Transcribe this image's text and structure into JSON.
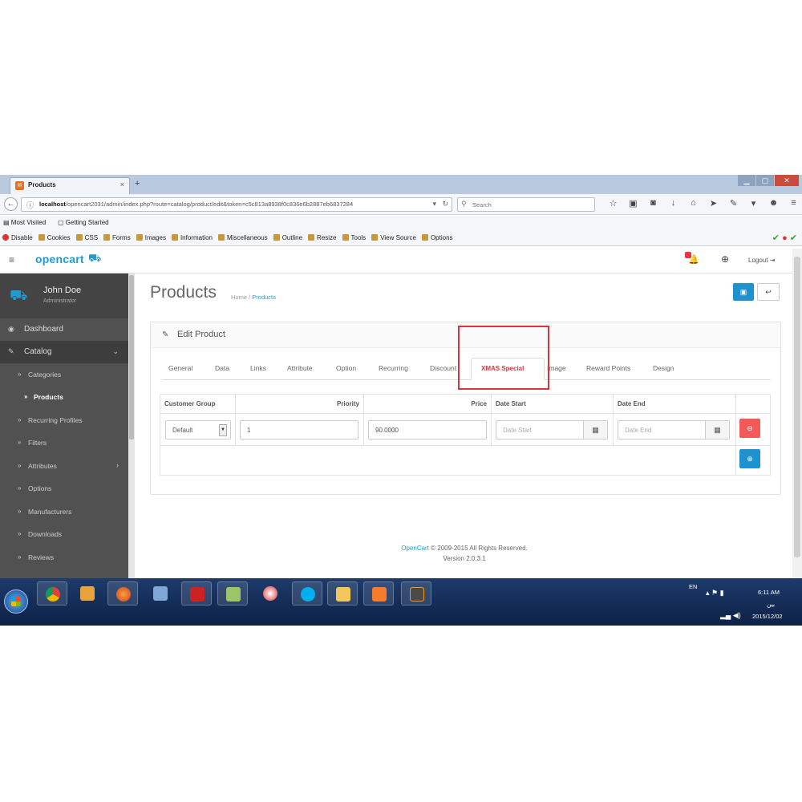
{
  "browser": {
    "tab_title": "Products",
    "tab_close": "×",
    "new_tab": "+",
    "win_min": "▁",
    "win_max": "▢",
    "win_close": "✕",
    "url_host": "localhost",
    "url_path": "/opencart2031/admin/index.php?route=catalog/product/edit&token=c5c813a8938f0c836e6b2887eb6837284",
    "search_placeholder": "Search",
    "bookmarks": [
      "Most Visited",
      "Getting Started"
    ],
    "dev_toolbar": [
      "Disable",
      "Cookies",
      "CSS",
      "Forms",
      "Images",
      "Information",
      "Miscellaneous",
      "Outline",
      "Resize",
      "Tools",
      "View Source",
      "Options"
    ]
  },
  "header": {
    "logo": "opencart",
    "logout": "Logout"
  },
  "sidebar": {
    "user_name": "John Doe",
    "user_role": "Administrator",
    "top_items": [
      {
        "label": "Dashboard"
      },
      {
        "label": "Catalog"
      }
    ],
    "sub_items": [
      {
        "label": "Categories"
      },
      {
        "label": "Products"
      },
      {
        "label": "Recurring Profiles"
      },
      {
        "label": "Filters"
      },
      {
        "label": "Attributes"
      },
      {
        "label": "Options"
      },
      {
        "label": "Manufacturers"
      },
      {
        "label": "Downloads"
      },
      {
        "label": "Reviews"
      }
    ]
  },
  "main": {
    "page_title": "Products",
    "breadcrumb_home": "Home",
    "breadcrumb_sep": "/",
    "breadcrumb_current": "Products",
    "panel_title": "Edit Product",
    "tabs": [
      "General",
      "Data",
      "Links",
      "Attribute",
      "Option",
      "Recurring",
      "Discount",
      "XMAS Special",
      "Image",
      "Reward Points",
      "Design"
    ],
    "table": {
      "headers": [
        "Customer Group",
        "Priority",
        "Price",
        "Date Start",
        "Date End"
      ],
      "row": {
        "customer_group": "Default",
        "priority": "1",
        "price": "90.0000",
        "date_start_placeholder": "Date Start",
        "date_end_placeholder": "Date End"
      }
    },
    "footer_link": "OpenCart",
    "footer_text": "© 2009-2015 All Rights Reserved.",
    "footer_version": "Version 2.0.3.1"
  },
  "taskbar": {
    "lang": "EN",
    "time": "6:11 AM",
    "day": "بين",
    "date": "2015/12/02"
  },
  "colors": {
    "accent": "#1e91cf",
    "danger": "#f25a5a",
    "highlight": "#e0323a",
    "sidebar": "#515151"
  }
}
